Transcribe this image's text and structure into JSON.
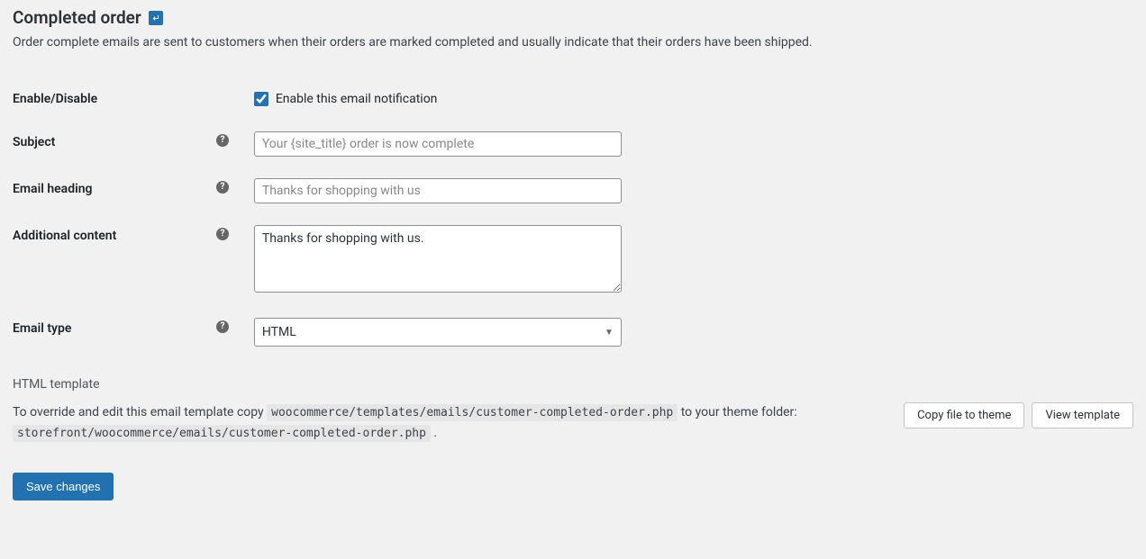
{
  "page": {
    "title": "Completed order",
    "description": "Order complete emails are sent to customers when their orders are marked completed and usually indicate that their orders have been shipped."
  },
  "fields": {
    "enable": {
      "label": "Enable/Disable",
      "checkbox_label": "Enable this email notification"
    },
    "subject": {
      "label": "Subject",
      "placeholder": "Your {site_title} order is now complete",
      "value": ""
    },
    "heading": {
      "label": "Email heading",
      "placeholder": "Thanks for shopping with us",
      "value": ""
    },
    "additional": {
      "label": "Additional content",
      "value": "Thanks for shopping with us."
    },
    "email_type": {
      "label": "Email type",
      "value": "HTML"
    }
  },
  "template": {
    "heading": "HTML template",
    "text_prefix": "To override and edit this email template copy ",
    "source_path": "woocommerce/templates/emails/customer-completed-order.php",
    "text_middle": " to your theme folder: ",
    "dest_path": "storefront/woocommerce/emails/customer-completed-order.php",
    "text_suffix": " .",
    "copy_button": "Copy file to theme",
    "view_button": "View template"
  },
  "actions": {
    "save": "Save changes"
  },
  "help_glyph": "?"
}
